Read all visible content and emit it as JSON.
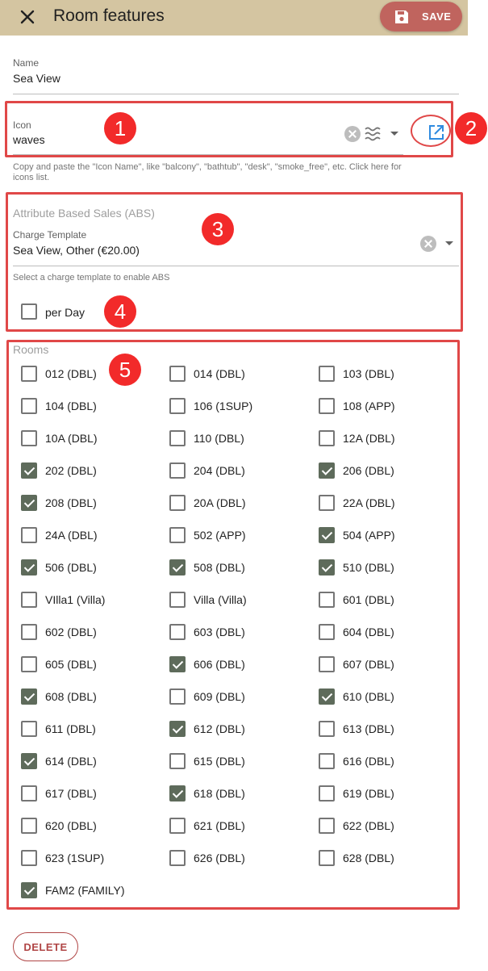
{
  "header": {
    "title": "Room features",
    "save_label": "SAVE"
  },
  "name_field": {
    "label": "Name",
    "value": "Sea View"
  },
  "icon_field": {
    "label": "Icon",
    "value": "waves",
    "hint": "Copy and paste the \"Icon Name\", like \"balcony\", \"bathtub\", \"desk\", \"smoke_free\", etc. Click here for icons list."
  },
  "abs": {
    "title": "Attribute Based Sales (ABS)",
    "charge_label": "Charge Template",
    "charge_value": "Sea View, Other (€20.00)",
    "hint": "Select a charge template to enable ABS",
    "per_day_label": "per Day"
  },
  "rooms": {
    "title": "Rooms",
    "items": [
      {
        "label": "012 (DBL)",
        "checked": false
      },
      {
        "label": "014 (DBL)",
        "checked": false
      },
      {
        "label": "103 (DBL)",
        "checked": false
      },
      {
        "label": "104 (DBL)",
        "checked": false
      },
      {
        "label": "106 (1SUP)",
        "checked": false
      },
      {
        "label": "108 (APP)",
        "checked": false
      },
      {
        "label": "10A (DBL)",
        "checked": false
      },
      {
        "label": "110 (DBL)",
        "checked": false
      },
      {
        "label": "12A (DBL)",
        "checked": false
      },
      {
        "label": "202 (DBL)",
        "checked": true
      },
      {
        "label": "204 (DBL)",
        "checked": false
      },
      {
        "label": "206 (DBL)",
        "checked": true
      },
      {
        "label": "208 (DBL)",
        "checked": true
      },
      {
        "label": "20A (DBL)",
        "checked": false
      },
      {
        "label": "22A (DBL)",
        "checked": false
      },
      {
        "label": "24A (DBL)",
        "checked": false
      },
      {
        "label": "502 (APP)",
        "checked": false
      },
      {
        "label": "504 (APP)",
        "checked": true
      },
      {
        "label": "506 (DBL)",
        "checked": true
      },
      {
        "label": "508 (DBL)",
        "checked": true
      },
      {
        "label": "510 (DBL)",
        "checked": true
      },
      {
        "label": "VIlla1 (Villa)",
        "checked": false
      },
      {
        "label": "Villa (Villa)",
        "checked": false
      },
      {
        "label": "601 (DBL)",
        "checked": false
      },
      {
        "label": "602 (DBL)",
        "checked": false
      },
      {
        "label": "603 (DBL)",
        "checked": false
      },
      {
        "label": "604 (DBL)",
        "checked": false
      },
      {
        "label": "605 (DBL)",
        "checked": false
      },
      {
        "label": "606 (DBL)",
        "checked": true
      },
      {
        "label": "607 (DBL)",
        "checked": false
      },
      {
        "label": "608 (DBL)",
        "checked": true
      },
      {
        "label": "609 (DBL)",
        "checked": false
      },
      {
        "label": "610 (DBL)",
        "checked": true
      },
      {
        "label": "611 (DBL)",
        "checked": false
      },
      {
        "label": "612 (DBL)",
        "checked": true
      },
      {
        "label": "613 (DBL)",
        "checked": false
      },
      {
        "label": "614 (DBL)",
        "checked": true
      },
      {
        "label": "615 (DBL)",
        "checked": false
      },
      {
        "label": "616 (DBL)",
        "checked": false
      },
      {
        "label": "617 (DBL)",
        "checked": false
      },
      {
        "label": "618 (DBL)",
        "checked": true
      },
      {
        "label": "619 (DBL)",
        "checked": false
      },
      {
        "label": "620 (DBL)",
        "checked": false
      },
      {
        "label": "621 (DBL)",
        "checked": false
      },
      {
        "label": "622 (DBL)",
        "checked": false
      },
      {
        "label": "623 (1SUP)",
        "checked": false
      },
      {
        "label": "626 (DBL)",
        "checked": false
      },
      {
        "label": "628 (DBL)",
        "checked": false
      },
      {
        "label": "FAM2 (FAMILY)",
        "checked": true
      }
    ]
  },
  "footer": {
    "delete_label": "DELETE"
  },
  "annotations": [
    "1",
    "2",
    "3",
    "4",
    "5"
  ],
  "colors": {
    "header_bg": "#d4c5a1",
    "save_bg": "#c0645e",
    "checked": "#5e6b5b",
    "annotation_red": "#f22a2a",
    "link_blue": "#2f8be0"
  }
}
